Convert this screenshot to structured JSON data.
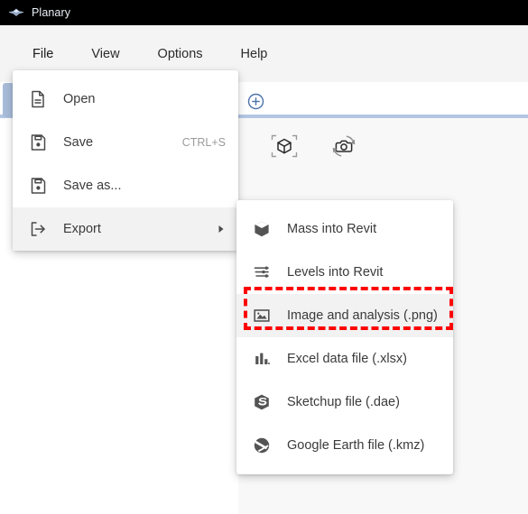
{
  "window": {
    "title": "Planary",
    "logo_icon": "winged-diamond-logo-icon"
  },
  "menubar": {
    "items": [
      {
        "label": "File",
        "name": "menubar-item-file",
        "active": true
      },
      {
        "label": "View",
        "name": "menubar-item-view",
        "active": false
      },
      {
        "label": "Options",
        "name": "menubar-item-options",
        "active": false
      },
      {
        "label": "Help",
        "name": "menubar-item-help",
        "active": false
      }
    ]
  },
  "tabstrip": {
    "add_tab_icon": "plus-circle-icon"
  },
  "canvas_toolbar": {
    "buttons": [
      {
        "icon": "3d-cube-view-icon",
        "name": "tool-3d-view"
      },
      {
        "icon": "camera-rotate-icon",
        "name": "tool-camera-rotate"
      }
    ]
  },
  "file_menu": {
    "items": [
      {
        "label": "Open",
        "icon": "document-icon",
        "shortcut": "",
        "submenu": false,
        "highlighted": false
      },
      {
        "label": "Save",
        "icon": "floppy-disk-icon",
        "shortcut": "CTRL+S",
        "submenu": false,
        "highlighted": false
      },
      {
        "label": "Save as...",
        "icon": "floppy-disk-icon",
        "shortcut": "",
        "submenu": false,
        "highlighted": false
      },
      {
        "label": "Export",
        "icon": "export-arrow-icon",
        "shortcut": "",
        "submenu": true,
        "highlighted": true
      }
    ]
  },
  "export_menu": {
    "items": [
      {
        "label": "Mass into Revit",
        "icon": "cube-solid-icon",
        "highlighted": false
      },
      {
        "label": "Levels into Revit",
        "icon": "levels-icon",
        "highlighted": false
      },
      {
        "label": "Image and analysis (.png)",
        "icon": "image-icon",
        "highlighted": true
      },
      {
        "label": "Excel data file (.xlsx)",
        "icon": "bar-chart-icon",
        "highlighted": false
      },
      {
        "label": "Sketchup file (.dae)",
        "icon": "sketchup-icon",
        "highlighted": false
      },
      {
        "label": "Google Earth file (.kmz)",
        "icon": "globe-icon",
        "highlighted": false
      }
    ]
  },
  "annotation": {
    "target_label": "Image and analysis (.png)",
    "color": "#ff0000",
    "style": "dashed-rectangle"
  },
  "colors": {
    "titlebar_bg": "#000000",
    "titlebar_text": "#e9eef6",
    "menu_bg": "#ffffff",
    "menu_highlight": "#f2f2f2",
    "menu_text": "#3a3a3a",
    "shortcut_text": "#9a9a9a",
    "accent_blue": "#4a72ab",
    "separator_blue": "#b3c6e3",
    "canvas_bg": "#f8f8f8",
    "top_strip_bg": "#f4f4f4",
    "annotation_red": "#ff0000"
  }
}
